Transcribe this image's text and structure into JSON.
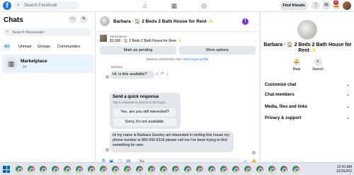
{
  "topbar": {
    "search_placeholder": "Search Facebook",
    "find_friends": "Find friends",
    "notif_count": "1"
  },
  "sidebar": {
    "title": "Chats",
    "search_placeholder": "Search Messenger",
    "filters": [
      "All",
      "Unread",
      "Groups",
      "Communities"
    ],
    "conversation": {
      "name": "Marketplace",
      "time": "· 1h"
    }
  },
  "chat": {
    "header_title": "Barbara · 🏠 2 Beds 2 Bath House for Rent ✨",
    "listing_label": "Marketplace",
    "listing_title": "$1,500 · 🏠 2 Beds 2 Bath House for Rent ✨",
    "mark_pending": "Mark as pending",
    "more_options": "More options",
    "started_text": "Barbara started this chat.",
    "view_profile": "View buyer profile",
    "sender_name": "Barbara",
    "first_message": "Hi, is this available?",
    "quick_title": "Send a quick response",
    "quick_subtitle": "Tap a response to send it to the buyer.",
    "quick_options": [
      "Yes, are you still interested?",
      "Sorry, it's not available."
    ],
    "long_message": "Hi my name is Barbara Gourley am interested in renting this house my phone number is 865 599 6319 please call me I've been trying to find something for wee",
    "composer_placeholder": "Aa"
  },
  "right_panel": {
    "title": "Barbara · 🏠 2 Beds 2 Bath House for Rent ✨",
    "actions": [
      "Mute",
      "Search"
    ],
    "sections": [
      "Customize chat",
      "Chat members",
      "Media, files and links",
      "Privacy & support"
    ]
  },
  "taskbar": {
    "time": "12:41 AM",
    "date": "10/25/202"
  }
}
